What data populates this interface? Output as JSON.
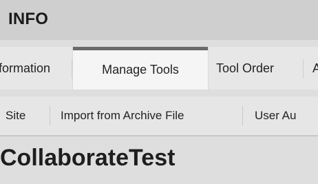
{
  "header": {
    "title": "INFO"
  },
  "tabs": [
    {
      "label": "formation"
    },
    {
      "label": "Manage Tools"
    },
    {
      "label": "Tool Order"
    },
    {
      "label": "A"
    }
  ],
  "subnav": [
    {
      "label": "Site"
    },
    {
      "label": "Import from Archive File"
    },
    {
      "label": "User Au"
    }
  ],
  "main": {
    "site_title": "CollaborateTest"
  }
}
